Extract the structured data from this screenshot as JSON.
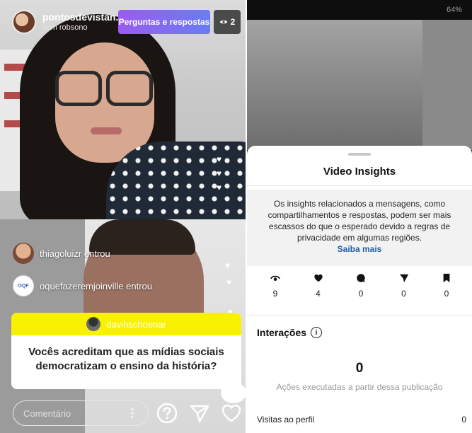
{
  "live": {
    "host_name": "pontosdevistan...",
    "host_sub": "com robsono",
    "qa_button": "Perguntas e respostas",
    "viewer_count": "2",
    "joins": [
      {
        "user": "thiagoluizr entrou"
      },
      {
        "user": "oquefazeremjoinville entrou"
      }
    ],
    "question": {
      "author": "davihschoenar",
      "text": "Vocês acreditam que as mídias sociais democratizam o ensino da história?"
    },
    "comment_placeholder": "Comentário",
    "icons": [
      "question-circle-icon",
      "send-icon",
      "heart-icon"
    ]
  },
  "insights": {
    "status": "64%",
    "title": "Video Insights",
    "notice": "Os insights relacionados a mensagens, como compartilhamentos e respostas, podem ser mais escassos do que o esperado devido a regras de privacidade em algumas regiões.",
    "notice_link": "Saiba mais",
    "metrics": [
      {
        "icon": "eye-icon",
        "value": "9"
      },
      {
        "icon": "heart-icon",
        "value": "4"
      },
      {
        "icon": "comment-icon",
        "value": "0"
      },
      {
        "icon": "send-icon",
        "value": "0"
      },
      {
        "icon": "bookmark-icon",
        "value": "0"
      }
    ],
    "section_title": "Interações",
    "actions_value": "0",
    "actions_label": "Ações executadas a partir dessa publicação",
    "profile_visits_label": "Visitas ao perfil",
    "profile_visits_value": "0"
  },
  "colors": {
    "qa_gradient_start": "#9a5cf0",
    "qa_gradient_end": "#6a7cf3",
    "question_header": "#f8f100",
    "link": "#1f5fa8"
  }
}
